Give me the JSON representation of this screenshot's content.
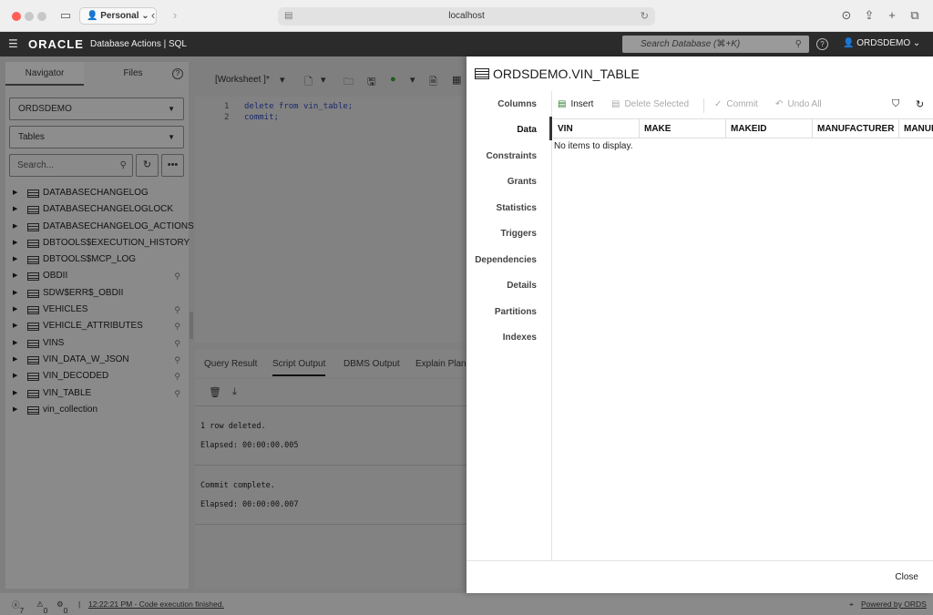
{
  "browser": {
    "profile": "Personal",
    "url": "localhost"
  },
  "header": {
    "brand": "ORACLE",
    "product": "Database Actions | SQL",
    "search_placeholder": "Search Database (⌘+K)",
    "user": "ORDSDEMO"
  },
  "navigator": {
    "tabs": [
      "Navigator",
      "Files"
    ],
    "schema": "ORDSDEMO",
    "object_type": "Tables",
    "search_placeholder": "Search...",
    "items": [
      {
        "name": "DATABASECHANGELOG",
        "pinned": false
      },
      {
        "name": "DATABASECHANGELOGLOCK",
        "pinned": false
      },
      {
        "name": "DATABASECHANGELOG_ACTIONS",
        "pinned": false
      },
      {
        "name": "DBTOOLS$EXECUTION_HISTORY",
        "pinned": false
      },
      {
        "name": "DBTOOLS$MCP_LOG",
        "pinned": false
      },
      {
        "name": "OBDII",
        "pinned": true
      },
      {
        "name": "SDW$ERR$_OBDII",
        "pinned": false
      },
      {
        "name": "VEHICLES",
        "pinned": true
      },
      {
        "name": "VEHICLE_ATTRIBUTES",
        "pinned": true
      },
      {
        "name": "VINS",
        "pinned": true
      },
      {
        "name": "VIN_DATA_W_JSON",
        "pinned": true
      },
      {
        "name": "VIN_DECODED",
        "pinned": true
      },
      {
        "name": "VIN_TABLE",
        "pinned": true
      },
      {
        "name": "vin_collection",
        "pinned": false
      }
    ]
  },
  "worksheet": {
    "title": "[Worksheet ]*",
    "lines": [
      {
        "num": "1",
        "text": "delete from vin_table;"
      },
      {
        "num": "2",
        "text": "commit;"
      }
    ]
  },
  "output": {
    "tabs": [
      "Query Result",
      "Script Output",
      "DBMS Output",
      "Explain Plan"
    ],
    "active_tab": "Script Output",
    "messages": [
      "1 row deleted.",
      "Elapsed: 00:00:00.005",
      "Commit complete.",
      "Elapsed: 00:00:00.007"
    ]
  },
  "panel": {
    "title": "ORDSDEMO.VIN_TABLE",
    "nav": [
      "Columns",
      "Data",
      "Constraints",
      "Grants",
      "Statistics",
      "Triggers",
      "Dependencies",
      "Details",
      "Partitions",
      "Indexes"
    ],
    "active_nav": "Data",
    "toolbar": {
      "insert": "Insert",
      "delete_selected": "Delete Selected",
      "commit": "Commit",
      "undo_all": "Undo All"
    },
    "columns": [
      "VIN",
      "MAKE",
      "MAKEID",
      "MANUFACTURER",
      "MANUFACTURERID"
    ],
    "empty_message": "No items to display.",
    "close": "Close"
  },
  "status": {
    "errors": "7",
    "warnings": "0",
    "jobs": "0",
    "message": "12:22:21 PM - Code execution finished.",
    "powered": "Powered by ORDS"
  }
}
